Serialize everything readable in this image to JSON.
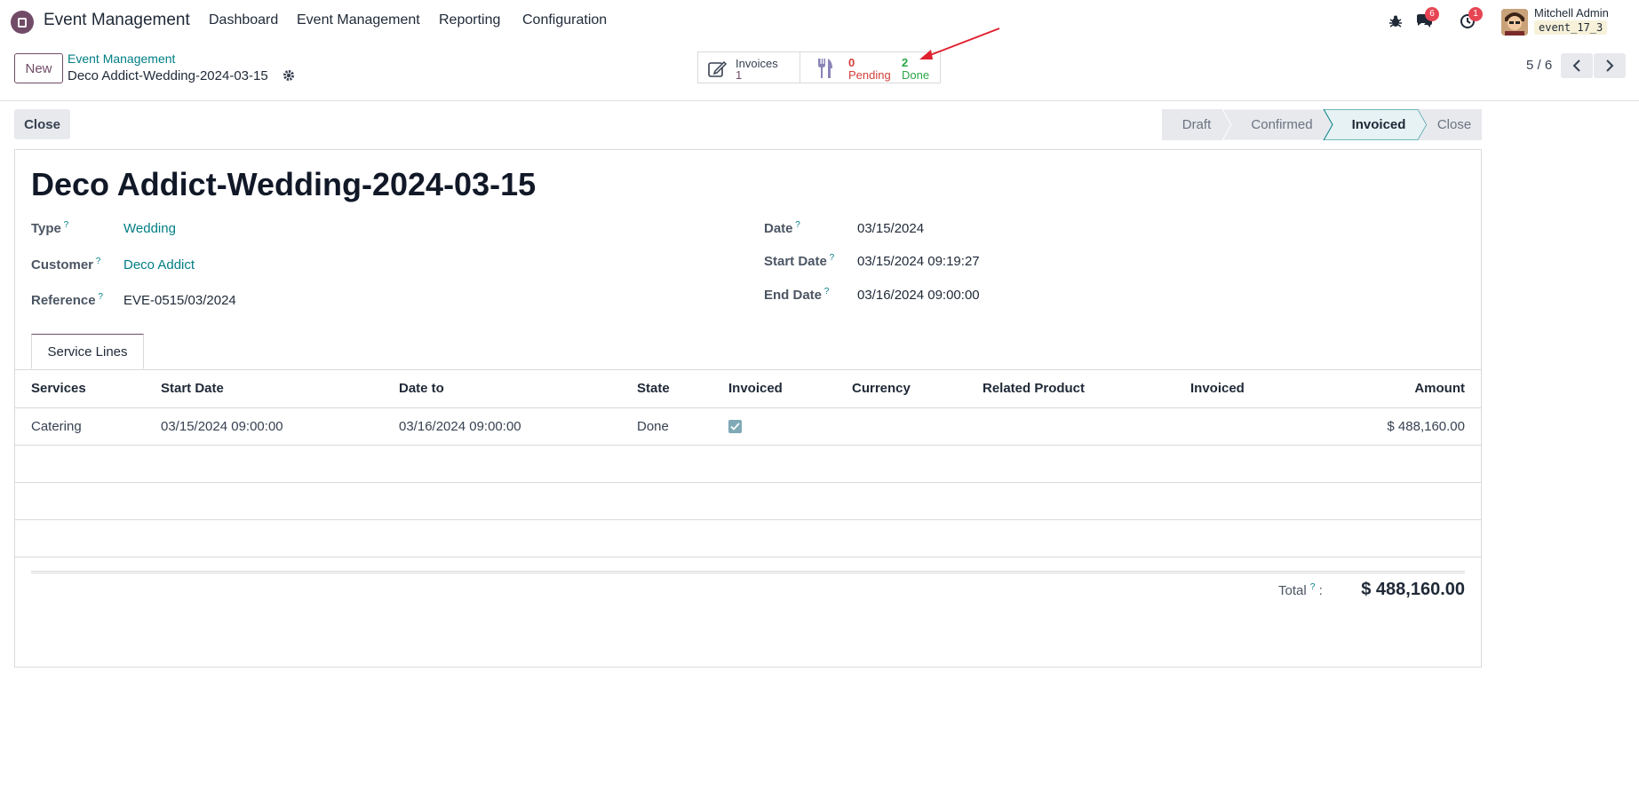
{
  "navbar": {
    "brand": "Event Management",
    "menu": [
      "Dashboard",
      "Event Management",
      "Reporting",
      "Configuration"
    ],
    "chat_badge": "6",
    "activity_badge": "1",
    "user_name": "Mitchell Admin",
    "db_name": "event_17_3"
  },
  "control": {
    "new_label": "New",
    "breadcrumb_parent": "Event Management",
    "breadcrumb_current": "Deco Addict-Wedding-2024-03-15",
    "invoices_label": "Invoices",
    "invoices_count": "1",
    "pending_count": "0",
    "pending_label": "Pending",
    "done_count": "2",
    "done_label": "Done",
    "pager": "5 / 6"
  },
  "status": {
    "close_button": "Close",
    "stages": [
      "Draft",
      "Confirmed",
      "Invoiced",
      "Close"
    ],
    "active_stage": "Invoiced"
  },
  "form": {
    "title": "Deco Addict-Wedding-2024-03-15",
    "type_label": "Type",
    "type_value": "Wedding",
    "customer_label": "Customer",
    "customer_value": "Deco Addict",
    "reference_label": "Reference",
    "reference_value": "EVE-0515/03/2024",
    "date_label": "Date",
    "date_value": "03/15/2024",
    "start_label": "Start Date",
    "start_value": "03/15/2024 09:19:27",
    "end_label": "End Date",
    "end_value": "03/16/2024 09:00:00",
    "tab_label": "Service Lines"
  },
  "table": {
    "headers": [
      "Services",
      "Start Date",
      "Date to",
      "State",
      "Invoiced",
      "Currency",
      "Related Product",
      "Invoiced",
      "Amount"
    ],
    "rows": [
      {
        "service": "Catering",
        "start": "03/15/2024 09:00:00",
        "end": "03/16/2024 09:00:00",
        "state": "Done",
        "invoiced": true,
        "currency": "",
        "product": "",
        "invoiced2": "",
        "amount": "$ 488,160.00"
      }
    ]
  },
  "total": {
    "label": "Total",
    "value": "$ 488,160.00"
  },
  "colors": {
    "brand": "#714B67",
    "link": "#017e84",
    "pending": "#d23f3a",
    "done": "#28a745",
    "annotation_arrow": "#e0202e"
  }
}
